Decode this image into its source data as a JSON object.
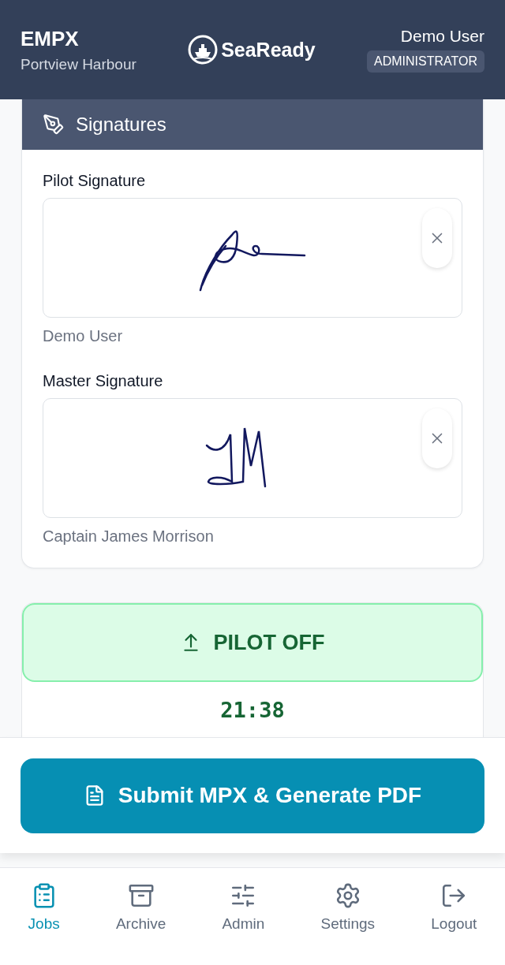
{
  "header": {
    "title": "EMPX",
    "subtitle": "Portview Harbour",
    "logo_text": "SeaReady",
    "user": "Demo User",
    "role": "ADMINISTRATOR"
  },
  "signatures_card": {
    "title": "Signatures",
    "items": [
      {
        "label": "Pilot Signature",
        "kind": "pilot",
        "name": "Demo User"
      },
      {
        "label": "Master Signature",
        "kind": "master",
        "name": "Captain James Morrison"
      }
    ]
  },
  "pilot_off": {
    "label": "PILOT OFF",
    "time": "21:38"
  },
  "submit_button": {
    "label": "Submit MPX & Generate PDF"
  },
  "nav": [
    {
      "label": "Jobs",
      "kind": "jobs",
      "selected": true
    },
    {
      "label": "Archive",
      "kind": "archive",
      "selected": false
    },
    {
      "label": "Admin",
      "kind": "admin",
      "selected": false
    },
    {
      "label": "Settings",
      "kind": "settings",
      "selected": false
    },
    {
      "label": "Logout",
      "kind": "logout",
      "selected": false
    }
  ]
}
